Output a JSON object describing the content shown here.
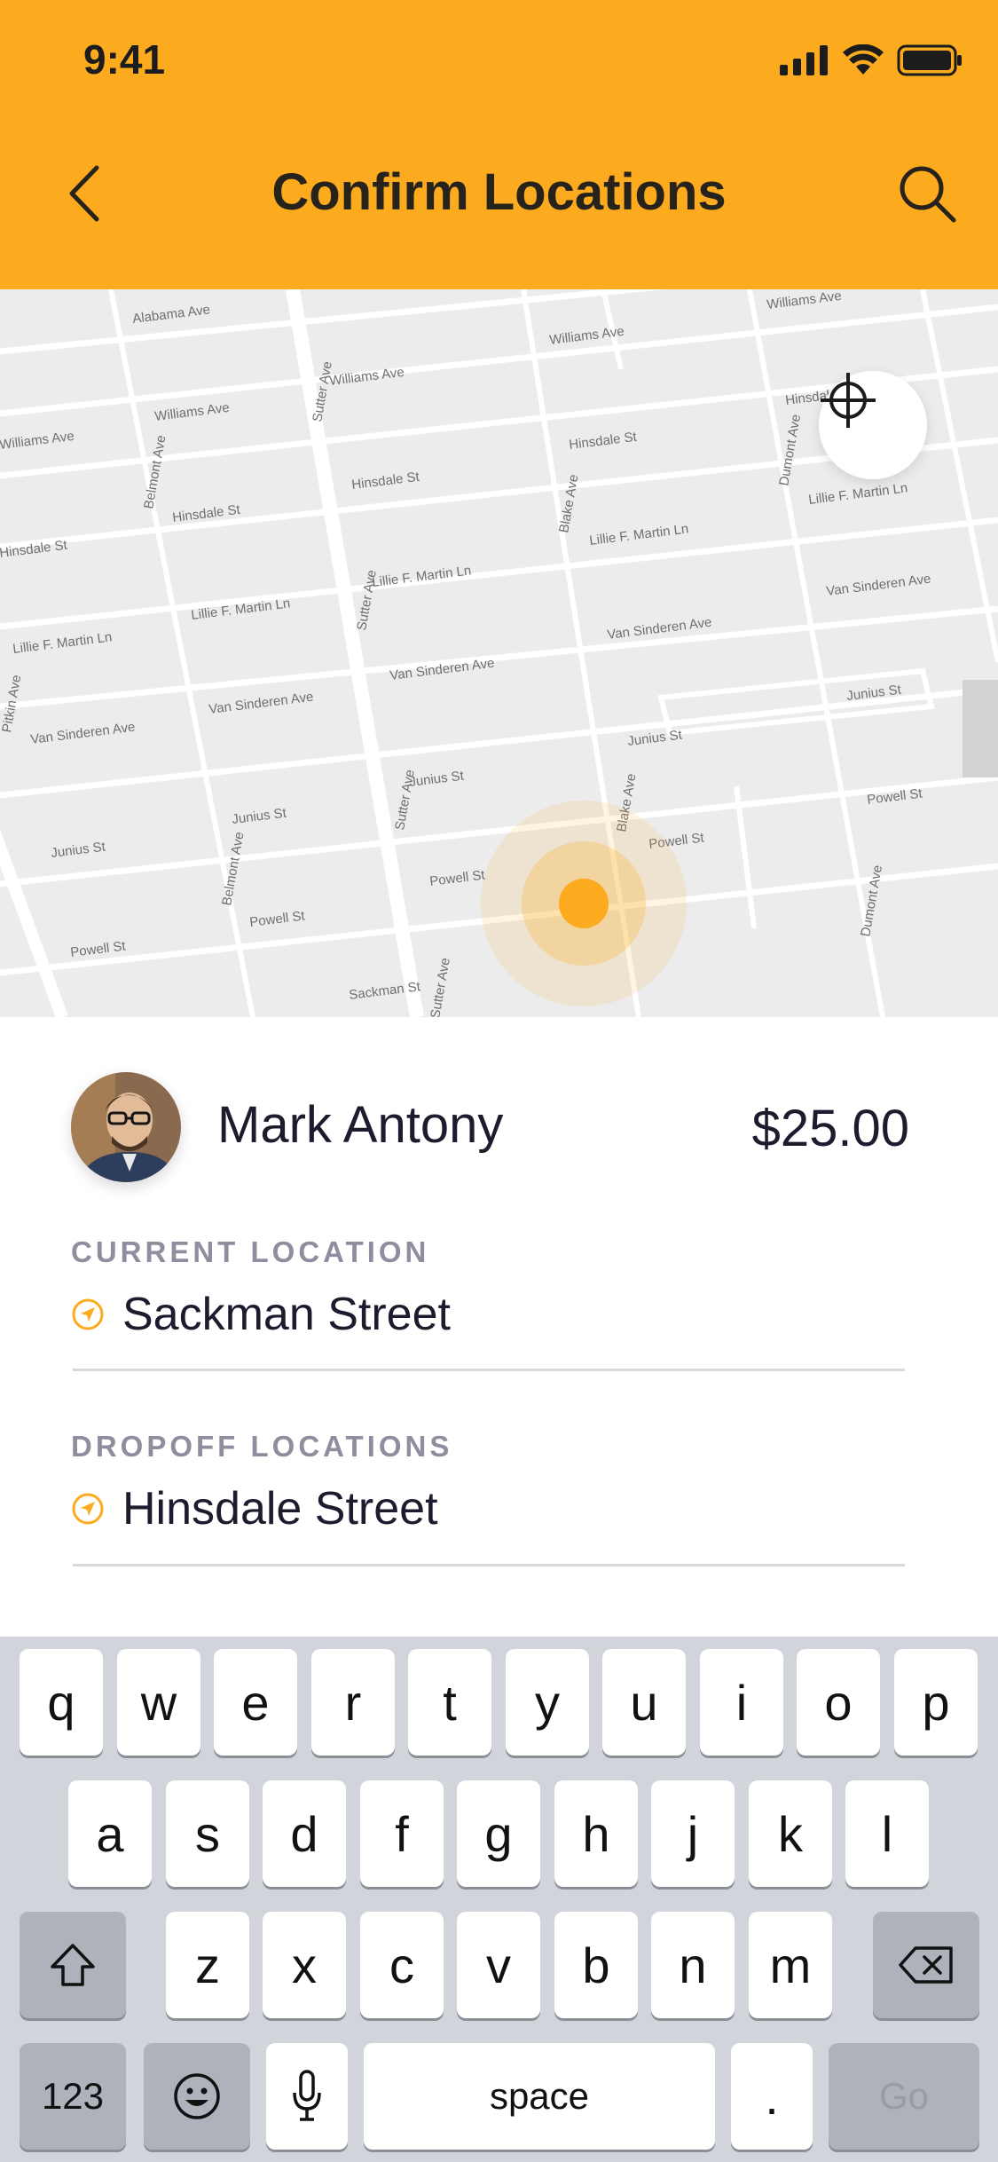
{
  "status_bar": {
    "time": "9:41"
  },
  "nav": {
    "title": "Confirm Locations",
    "back_icon": "chevron-left-icon",
    "search_icon": "search-icon"
  },
  "map": {
    "streets": [
      "Alabama Ave",
      "Williams Ave",
      "Williams Ave",
      "Williams Ave",
      "Williams Ave",
      "Williams Ave",
      "Hinsdale St",
      "Hinsdale St",
      "Hinsdale St",
      "Hinsdale St",
      "Hinsdale St",
      "Lillie F. Martin Ln",
      "Lillie F. Martin Ln",
      "Lillie F. Martin Ln",
      "Lillie F. Martin Ln",
      "Lillie F. Martin Ln",
      "Van Sinderen Ave",
      "Van Sinderen Ave",
      "Van Sinderen Ave",
      "Van Sinderen Ave",
      "Van Sinderen Ave",
      "Junius St",
      "Junius St",
      "Junius St",
      "Junius St",
      "Junius St",
      "Powell St",
      "Powell St",
      "Powell St",
      "Powell St",
      "Powell St",
      "Sackman St",
      "Sutter Ave",
      "Sutter Ave",
      "Sutter Ave",
      "Sutter Ave",
      "Belmont Ave",
      "Belmont Ave",
      "Blake Ave",
      "Blake Ave",
      "Dumont Ave",
      "Dumont Ave",
      "Pitkin Ave"
    ],
    "accent": "#FDAB1E"
  },
  "rider": {
    "name": "Mark Antony",
    "fare": "$25.00"
  },
  "current": {
    "label": "CURRENT LOCATION",
    "value": "Sackman Street"
  },
  "dropoff": {
    "label": "DROPOFF LOCATIONS",
    "value": "Hinsdale Street"
  },
  "keyboard": {
    "row1": [
      "q",
      "w",
      "e",
      "r",
      "t",
      "y",
      "u",
      "i",
      "o",
      "p"
    ],
    "row2": [
      "a",
      "s",
      "d",
      "f",
      "g",
      "h",
      "j",
      "k",
      "l"
    ],
    "row3": [
      "z",
      "x",
      "c",
      "v",
      "b",
      "n",
      "m"
    ],
    "numbers": "123",
    "space": "space",
    "period": ".",
    "go": "Go"
  }
}
